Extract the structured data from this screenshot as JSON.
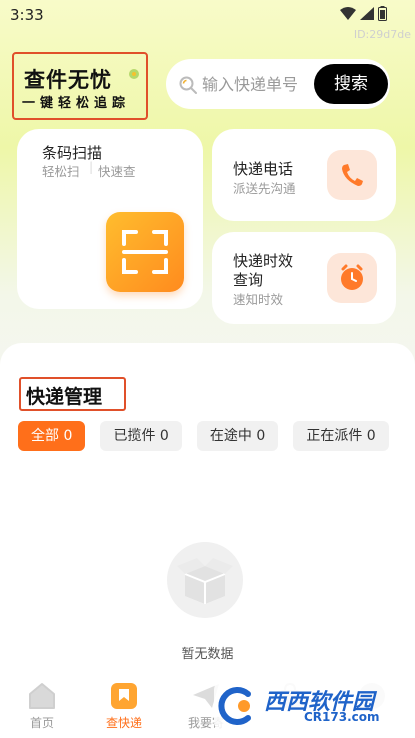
{
  "status_bar": {
    "time": "3:33",
    "device_id": "ID:29d7de"
  },
  "logo": {
    "title": "查件无忧",
    "subtitle": "一键轻松追踪"
  },
  "search": {
    "placeholder": "输入快递单号",
    "button_label": "搜索"
  },
  "cards": {
    "scan": {
      "title": "条码扫描",
      "subtitle_a": "轻松扫",
      "subtitle_b": "快速查"
    },
    "phone": {
      "title": "快递电话",
      "subtitle": "派送先沟通"
    },
    "timeliness": {
      "title_line1": "快递时效",
      "title_line2": "查询",
      "subtitle": "速知时效"
    }
  },
  "section": {
    "title": "快递管理"
  },
  "filters": [
    {
      "label": "全部 0",
      "active": true
    },
    {
      "label": "已揽件 0",
      "active": false
    },
    {
      "label": "在途中 0",
      "active": false
    },
    {
      "label": "正在派件 0",
      "active": false
    }
  ],
  "empty": {
    "text": "暂无数据"
  },
  "tabs": [
    {
      "label": "首页",
      "icon": "home-icon"
    },
    {
      "label": "查快递",
      "icon": "bookmark-icon"
    },
    {
      "label": "我要寄",
      "icon": "send-icon"
    },
    {
      "label": "",
      "icon": "bag-icon"
    },
    {
      "label": "",
      "icon": "user-icon"
    }
  ],
  "watermark": {
    "name": "西西软件园",
    "url": "CR173.com"
  },
  "colors": {
    "accent": "#ff6f1a",
    "highlight_border": "#e0502a",
    "search_button": "#000000"
  }
}
